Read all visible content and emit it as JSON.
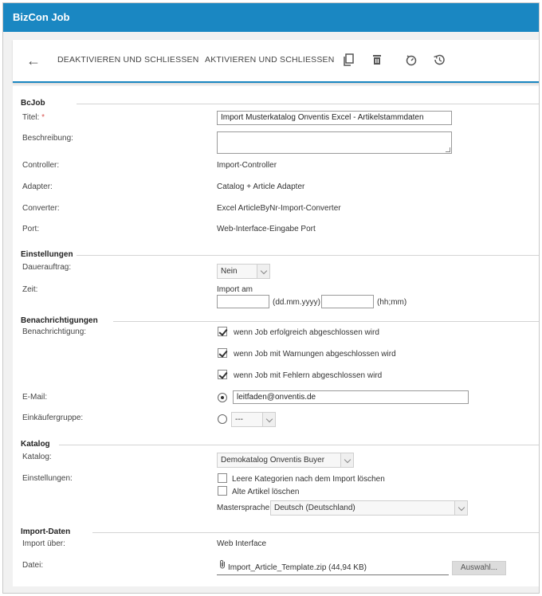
{
  "window": {
    "title": "BizCon Job"
  },
  "toolbar": {
    "deactivate_label": "DEAKTIVIEREN UND SCHLIESSEN",
    "activate_label": "AKTIVIEREN UND SCHLIESSEN",
    "icons": [
      "back-arrow-icon",
      "copy-icon",
      "delete-icon",
      "timer-icon",
      "history-icon"
    ]
  },
  "bcjob": {
    "section": "BcJob",
    "title_label": "Titel:",
    "required_mark": "*",
    "title_value": "Import Musterkatalog Onventis Excel - Artikelstammdaten",
    "description_label": "Beschreibung:",
    "description_value": "",
    "controller_label": "Controller:",
    "controller_value": "Import-Controller",
    "adapter_label": "Adapter:",
    "adapter_value": "Catalog + Article Adapter",
    "converter_label": "Converter:",
    "converter_value": "Excel ArticleByNr-Import-Converter",
    "port_label": "Port:",
    "port_value": "Web-Interface-Eingabe Port"
  },
  "einstellungen": {
    "section": "Einstellungen",
    "dauerauftrag_label": "Dauerauftrag:",
    "dauerauftrag_value": "Nein",
    "zeit_label": "Zeit:",
    "import_am": "Import am",
    "date_value": "",
    "date_hint": "(dd.mm.yyyy)",
    "time_value": "",
    "time_hint": "(hh;mm)"
  },
  "benachrichtigungen": {
    "section": "Benachrichtigungen",
    "label": "Benachrichtigung:",
    "options": [
      {
        "text": "wenn Job erfolgreich abgeschlossen wird",
        "checked": true
      },
      {
        "text": "wenn Job mit Warnungen abgeschlossen wird",
        "checked": true
      },
      {
        "text": "wenn Job mit Fehlern abgeschlossen wird",
        "checked": true
      }
    ],
    "email_label": "E-Mail:",
    "email_value": "leitfaden@onventis.de",
    "email_selected": true,
    "group_label": "Einkäufergruppe:",
    "group_value": "---",
    "group_selected": false
  },
  "katalog": {
    "section": "Katalog",
    "katalog_label": "Katalog:",
    "katalog_value": "Demokatalog Onventis Buyer",
    "settings_label": "Einstellungen:",
    "opt_empty_categories": "Leere Kategorien nach dem Import löschen",
    "opt_empty_categories_checked": false,
    "opt_delete_old": "Alte Artikel löschen",
    "opt_delete_old_checked": false,
    "mastersprache_label": "Mastersprache",
    "mastersprache_value": "Deutsch (Deutschland)"
  },
  "importdaten": {
    "section": "Import-Daten",
    "import_label": "Import über:",
    "import_value": "Web Interface",
    "file_label": "Datei:",
    "file_value": "Import_Article_Template.zip (44,94 KB)",
    "browse_label": "Auswahl..."
  },
  "colors": {
    "accent": "#1a87c2",
    "required": "#d9534f"
  }
}
